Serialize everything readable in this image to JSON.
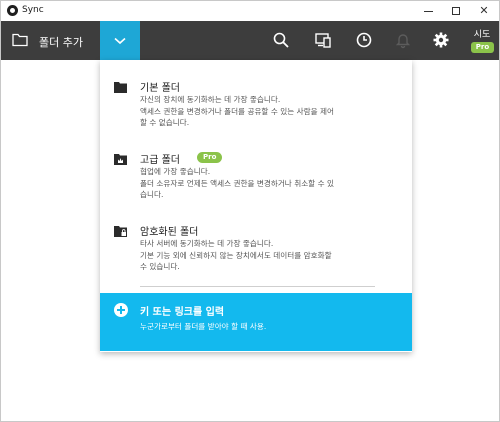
{
  "window": {
    "title": "Sync",
    "min_glyph": "",
    "max_glyph": "",
    "close_glyph": "✕"
  },
  "toolbar": {
    "add_folder_label": "폴더 추가",
    "profile_name": "시도",
    "profile_badge": "Pro",
    "icons": [
      "search-icon",
      "devices-icon",
      "clock-icon",
      "bell-icon",
      "gear-icon"
    ]
  },
  "menu": {
    "options": [
      {
        "title": "기본 폴더",
        "desc_lines": [
          "자신의 장치에 동기화하는 데 가장 좋습니다.",
          "액세스 권한을 변경하거나 폴더를 공유할 수 있는 사람을 제어",
          "할 수 없습니다."
        ]
      },
      {
        "title": "고급 폴더",
        "badge": "Pro",
        "desc_lines": [
          "협업에 가장 좋습니다.",
          "폴더 소유자로 언제든 액세스 권한을 변경하거나 취소할 수 있",
          "습니다."
        ]
      },
      {
        "title": "암호화된 폴더",
        "desc_lines": [
          "타사 서버에 동기화하는 데 가장 좋습니다.",
          "기본 기능 외에 신뢰하지 않는 장치에서도 데이터를 암호화할",
          "수 있습니다."
        ]
      }
    ],
    "enter_key": {
      "title": "키 또는 링크를 입력",
      "desc": "누군가로부터 폴더를 받아야 할 때 사용."
    }
  },
  "colors": {
    "toolbar_bg": "#3d3d3d",
    "accent_blue": "#1ea7d6",
    "enter_key_bg": "#13b9ee",
    "pro_green": "#8bc34a"
  }
}
